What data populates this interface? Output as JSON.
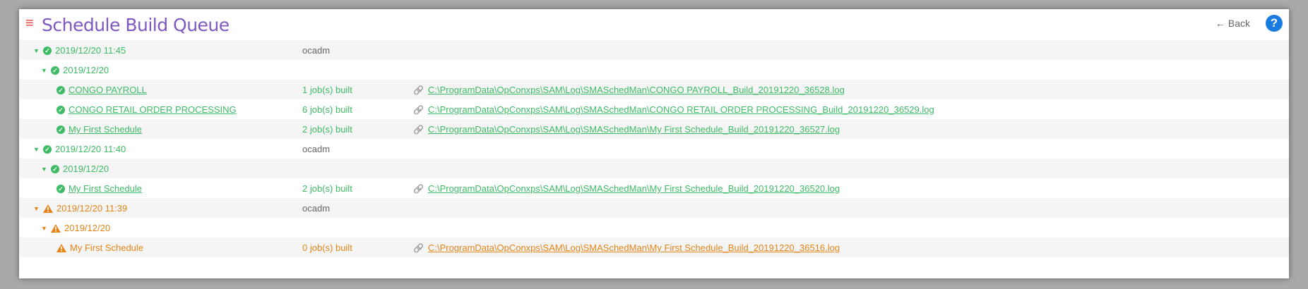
{
  "header": {
    "title": "Schedule Build Queue",
    "back_label": "Back",
    "help_label": "?"
  },
  "rows": [
    {
      "level": 0,
      "status": "ok",
      "name": "2019/12/20 11:45",
      "user": "ocadm",
      "jobs": "",
      "log": "",
      "link": false
    },
    {
      "level": 1,
      "status": "ok",
      "name": "2019/12/20",
      "user": "",
      "jobs": "",
      "log": "",
      "link": false
    },
    {
      "level": 2,
      "status": "ok",
      "name": "CONGO PAYROLL",
      "user": "",
      "jobs": "1 job(s) built",
      "log": "C:\\ProgramData\\OpConxps\\SAM\\Log\\SMASchedMan\\CONGO PAYROLL_Build_20191220_36528.log",
      "link": true
    },
    {
      "level": 2,
      "status": "ok",
      "name": "CONGO RETAIL ORDER PROCESSING",
      "user": "",
      "jobs": "6 job(s) built",
      "log": "C:\\ProgramData\\OpConxps\\SAM\\Log\\SMASchedMan\\CONGO RETAIL ORDER PROCESSING_Build_20191220_36529.log",
      "link": true
    },
    {
      "level": 2,
      "status": "ok",
      "name": "My First Schedule",
      "user": "",
      "jobs": "2 job(s) built",
      "log": "C:\\ProgramData\\OpConxps\\SAM\\Log\\SMASchedMan\\My First Schedule_Build_20191220_36527.log",
      "link": true
    },
    {
      "level": 0,
      "status": "ok",
      "name": "2019/12/20 11:40",
      "user": "ocadm",
      "jobs": "",
      "log": "",
      "link": false
    },
    {
      "level": 1,
      "status": "ok",
      "name": "2019/12/20",
      "user": "",
      "jobs": "",
      "log": "",
      "link": false
    },
    {
      "level": 2,
      "status": "ok",
      "name": "My First Schedule",
      "user": "",
      "jobs": "2 job(s) built",
      "log": "C:\\ProgramData\\OpConxps\\SAM\\Log\\SMASchedMan\\My First Schedule_Build_20191220_36520.log",
      "link": true
    },
    {
      "level": 0,
      "status": "warn",
      "name": "2019/12/20 11:39",
      "user": "ocadm",
      "jobs": "",
      "log": "",
      "link": false
    },
    {
      "level": 1,
      "status": "warn",
      "name": "2019/12/20",
      "user": "",
      "jobs": "",
      "log": "",
      "link": false
    },
    {
      "level": 2,
      "status": "warn",
      "name": "My First Schedule",
      "user": "",
      "jobs": "0 job(s) built",
      "log": "C:\\ProgramData\\OpConxps\\SAM\\Log\\SMASchedMan\\My First Schedule_Build_20191220_36516.log",
      "link": false
    }
  ],
  "colors": {
    "ok": "#3dbb65",
    "warn": "#e58417",
    "accent": "#7e57c2"
  }
}
